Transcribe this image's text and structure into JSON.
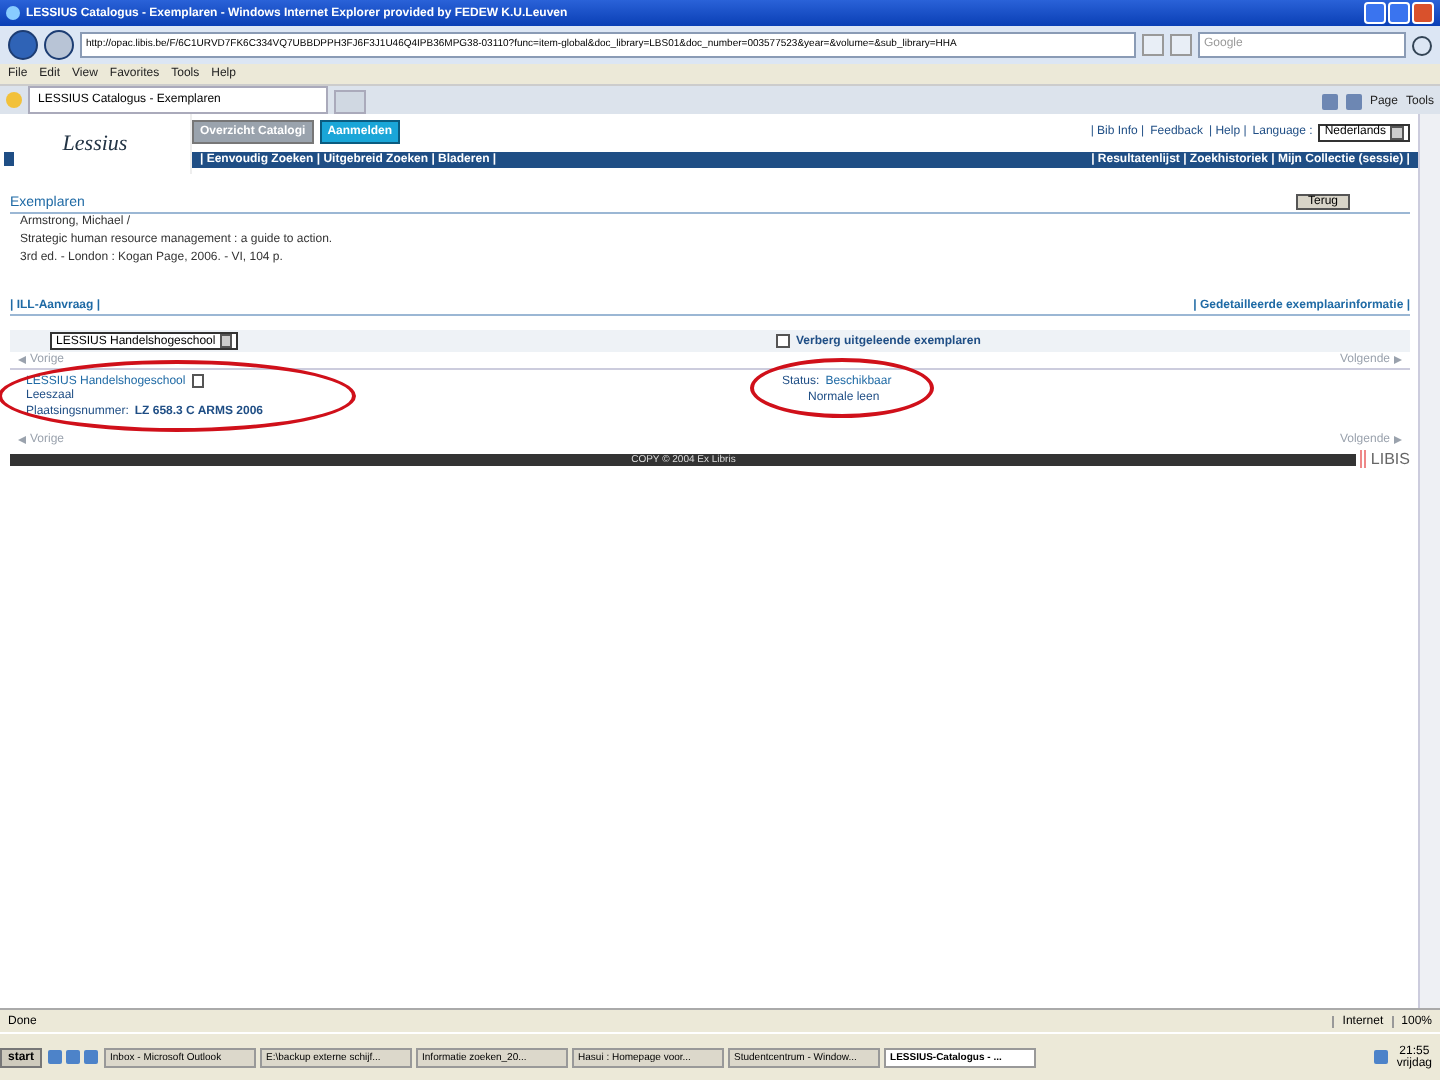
{
  "window": {
    "title": "LESSIUS Catalogus - Exemplaren - Windows Internet Explorer provided by FEDEW K.U.Leuven"
  },
  "address_bar": {
    "url": "http://opac.libis.be/F/6C1URVD7FK6C334VQ7UBBDPPH3FJ6F3J1U46Q4IPB36MPG38-03110?func=item-global&doc_library=LBS01&doc_number=003577523&year=&volume=&sub_library=HHA",
    "search_placeholder": "Google"
  },
  "menu": [
    "File",
    "Edit",
    "View",
    "Favorites",
    "Tools",
    "Help"
  ],
  "tabs": [
    {
      "label": "LESSIUS Catalogus - Exemplaren",
      "selected": true
    }
  ],
  "toolbar": [
    "Page",
    "Tools"
  ],
  "site": {
    "logo": "Lessius",
    "buttons": [
      {
        "label": "Overzicht Catalogi",
        "selected": false
      },
      {
        "label": "Aanmelden",
        "selected": true
      }
    ],
    "top_links": [
      "| Bib Info |",
      "Feedback",
      "| Help |",
      "Language :"
    ],
    "language": "Nederlands",
    "nav_left": "| Eenvoudig Zoeken | Uitgebreid Zoeken | Bladeren |",
    "nav_right": "| Resultatenlijst | Zoekhistoriek | Mijn Collectie (sessie) |"
  },
  "record": {
    "heading": "Exemplaren",
    "back_button": "Terug",
    "lines": [
      "Armstrong, Michael / ",
      "Strategic human resource management : a guide to action.",
      "3rd ed. - London : Kogan Page, 2006. - VI, 104 p."
    ]
  },
  "links": {
    "left": "| ILL-Aanvraag |",
    "right": "| Gedetailleerde exemplaarinformatie |"
  },
  "filter": {
    "library": "LESSIUS Handelshogeschool",
    "hide_label": "Verberg uitgeleende exemplaren",
    "hide_checked": false
  },
  "pager_top": {
    "prev": "Vorige",
    "next": "Volgende"
  },
  "holding": {
    "library": "LESSIUS Handelshogeschool",
    "location": "Leeszaal",
    "shelf_label": "Plaatsingsnummer:",
    "shelf_number": "LZ 658.3 C ARMS 2006",
    "circled": true,
    "status_label": "Status:",
    "status": "Beschikbaar",
    "loan": "Normale leen",
    "status_circled": true
  },
  "pager_bottom": {
    "prev": "Vorige",
    "next": "Volgende"
  },
  "footer": {
    "copyright": "COPY © 2004 Ex Libris",
    "logo": "LIBIS"
  },
  "status_bar": {
    "text": "Done",
    "zone": "Internet",
    "zoom": "100%"
  },
  "taskbar": {
    "start": "start",
    "items": [
      {
        "label": "Inbox - Microsoft Outlook",
        "selected": false
      },
      {
        "label": "E:\\backup externe schijf...",
        "selected": false
      },
      {
        "label": "Informatie zoeken_20...",
        "selected": false
      },
      {
        "label": "Hasui : Homepage voor...",
        "selected": false
      },
      {
        "label": "Studentcentrum - Window...",
        "selected": false
      },
      {
        "label": "LESSIUS-Catalogus - ...",
        "selected": true
      }
    ],
    "time": "21:55",
    "day": "vrijdag"
  }
}
